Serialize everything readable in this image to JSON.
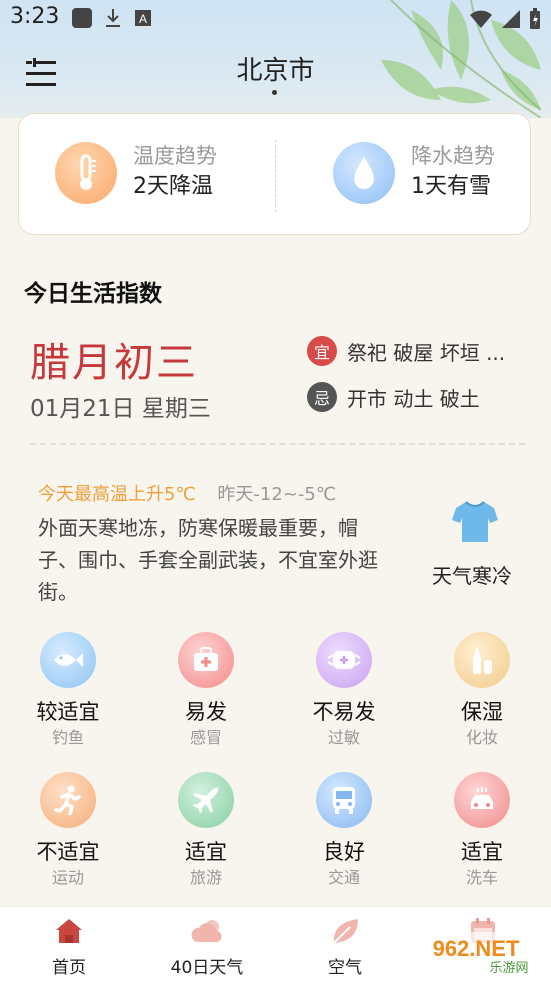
{
  "status_bar": {
    "time": "3:23"
  },
  "header": {
    "city": "北京市"
  },
  "trends": {
    "temperature": {
      "label": "温度趋势",
      "value": "2天降温"
    },
    "precipitation": {
      "label": "降水趋势",
      "value": "1天有雪"
    }
  },
  "life_index": {
    "title": "今日生活指数",
    "lunar_date": "腊月初三",
    "solar_date": "01月21日 星期三",
    "suitable": {
      "badge": "宜",
      "text": "祭祀 破屋 坏垣 ..."
    },
    "avoid": {
      "badge": "忌",
      "text": "开市 动土 破土"
    },
    "temp_rise": "今天最高温上升5℃",
    "yesterday": "昨天-12~-5℃",
    "advice": "外面天寒地冻，防寒保暖最重要，帽子、围巾、手套全副武装，不宜室外逛街。",
    "weather_label": "天气寒冷"
  },
  "indices": [
    {
      "level": "较适宜",
      "name": "钓鱼",
      "icon": "fish-icon"
    },
    {
      "level": "易发",
      "name": "感冒",
      "icon": "medkit-icon"
    },
    {
      "level": "不易发",
      "name": "过敏",
      "icon": "mask-icon"
    },
    {
      "level": "保湿",
      "name": "化妆",
      "icon": "cosmetics-icon"
    },
    {
      "level": "不适宜",
      "name": "运动",
      "icon": "running-icon"
    },
    {
      "level": "适宜",
      "name": "旅游",
      "icon": "airplane-icon"
    },
    {
      "level": "良好",
      "name": "交通",
      "icon": "bus-icon"
    },
    {
      "level": "适宜",
      "name": "洗车",
      "icon": "car-wash-icon"
    }
  ],
  "bottom_nav": [
    {
      "label": "首页",
      "icon": "home-icon"
    },
    {
      "label": "40日天气",
      "icon": "cloud-icon"
    },
    {
      "label": "空气",
      "icon": "leaf-icon"
    },
    {
      "label": "",
      "icon": "calendar-icon"
    }
  ],
  "watermark": {
    "text": "962.NET",
    "sub": "乐游网"
  },
  "colors": {
    "lunar": "#c6383a",
    "accent_orange": "#f0a03a",
    "suitable": "#d94a4a",
    "avoid": "#555555"
  }
}
